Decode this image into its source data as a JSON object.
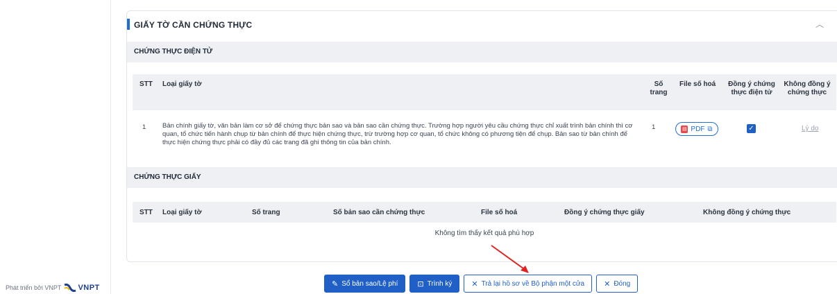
{
  "footer": {
    "brand_text": "Phát triển bởi VNPT",
    "logo_text": "VNPT"
  },
  "card": {
    "title": "GIẤY TỜ CẦN CHỨNG THỰC",
    "collapse_icon": "chevron-up-icon"
  },
  "electronic": {
    "section_title": "CHỨNG THỰC ĐIỆN TỬ",
    "headers": {
      "stt": "STT",
      "type": "Loại giấy tờ",
      "pages": "Số trang",
      "file": "File số hoá",
      "agree": "Đồng ý chứng thực điện tử",
      "disagree": "Không đồng ý chứng thực"
    },
    "row": {
      "stt": "1",
      "description": "Bản chính giấy tờ, văn bản làm cơ sở để chứng thực bản sao và bản sao cần chứng thực. Trường hợp người yêu cầu chứng thực chỉ xuất trình bản chính thì cơ quan, tổ chức tiến hành chụp từ bản chính để thực hiện chứng thực, trừ trường hợp cơ quan, tổ chức không có phương tiện để chụp. Bản sao từ bản chính để thực hiện chứng thực phải có đầy đủ các trang đã ghi thông tin của bản chính.",
      "pages": "1",
      "file_label": "PDF",
      "agreed": true,
      "reason_link": "Lý do"
    }
  },
  "paper": {
    "section_title": "CHỨNG THỰC GIẤY",
    "headers": {
      "stt": "STT",
      "type": "Loại giấy tờ",
      "pages": "Số trang",
      "copies": "Số bản sao cần chứng thực",
      "file": "File số hoá",
      "agree": "Đồng ý chứng thực giấy",
      "disagree": "Không đồng ý chứng thực"
    },
    "empty_message": "Không tìm thấy kết quả phù hợp"
  },
  "actions": {
    "fee_button": "Sổ bản sao/Lệ phí",
    "sign_button": "Trình ký",
    "return_button": "Trả lại hồ sơ về Bộ phận một cửa",
    "close_button": "Đóng"
  },
  "colors": {
    "primary": "#1f5fc6",
    "accent": "#1f6fd1",
    "arrow": "#e02424",
    "header_bg": "#eef0f3"
  }
}
